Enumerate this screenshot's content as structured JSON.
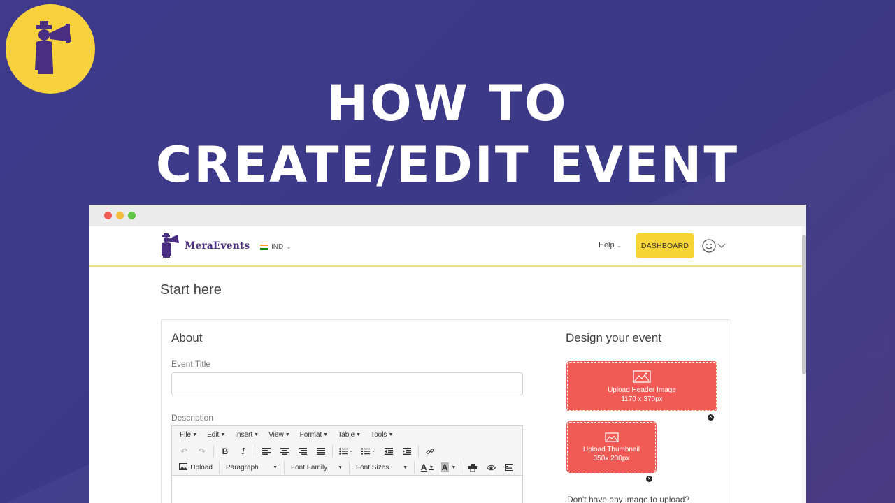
{
  "headline": {
    "line1": "HOW TO",
    "line2": "CREATE/EDIT EVENT"
  },
  "browser": {
    "dots": [
      "red",
      "yellow",
      "green"
    ]
  },
  "header": {
    "brand": "MeraEvents",
    "country": "IND",
    "help": "Help",
    "dashboard": "DASHBOARD",
    "user_icon": "smiley-icon"
  },
  "page": {
    "title": "Start here"
  },
  "about": {
    "title": "About",
    "event_title_label": "Event Title",
    "event_title_value": "",
    "description_label": "Description"
  },
  "editor": {
    "menus": [
      "File",
      "Edit",
      "Insert",
      "View",
      "Format",
      "Table",
      "Tools"
    ],
    "upload": "Upload",
    "paragraph": "Paragraph",
    "font_family": "Font Family",
    "font_sizes": "Font Sizes"
  },
  "design": {
    "title": "Design your event",
    "header_image_label": "Upload Header Image",
    "header_image_size": "1170 x 370px",
    "thumbnail_label": "Upload Thumbnail",
    "thumbnail_size": "350x 200px",
    "no_image_text": "Don't have any image to upload?"
  },
  "colors": {
    "background": "#3d3a88",
    "badge": "#f7d23c",
    "accent": "#f7d536",
    "upload": "#f25a55",
    "brand": "#4a2e82"
  }
}
